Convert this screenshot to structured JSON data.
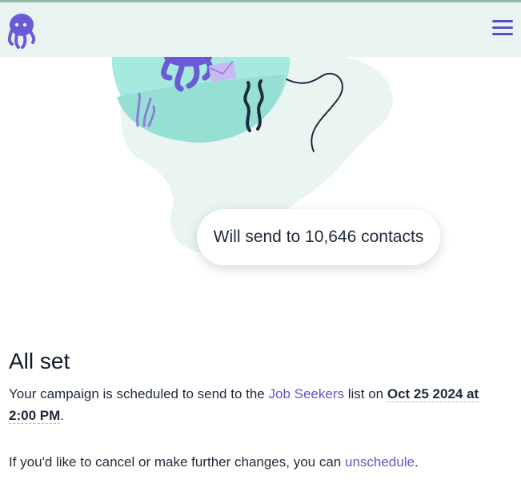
{
  "header": {
    "logo_icon": "octopus-logo-icon",
    "menu_icon": "hamburger-menu-icon",
    "background": "#e9f3f2",
    "accent": "#5b4fc7"
  },
  "illustration": {
    "bubble_text": "Will send to 10,646 contacts"
  },
  "confirmation": {
    "title": "All set",
    "line1_prefix": "Your campaign is scheduled to send to the ",
    "list_link": "Job Seekers",
    "line1_mid": " list on ",
    "scheduled_date": "Oct 25 2024 at 2:00 PM",
    "line1_end": ".",
    "line2_prefix": "If you'd like to cancel or make further changes, you can ",
    "unschedule_link": "unschedule",
    "line2_end": "."
  },
  "colors": {
    "link": "#6a52c9",
    "purple": "#6b5ad6",
    "teal": "#a6eadf"
  }
}
